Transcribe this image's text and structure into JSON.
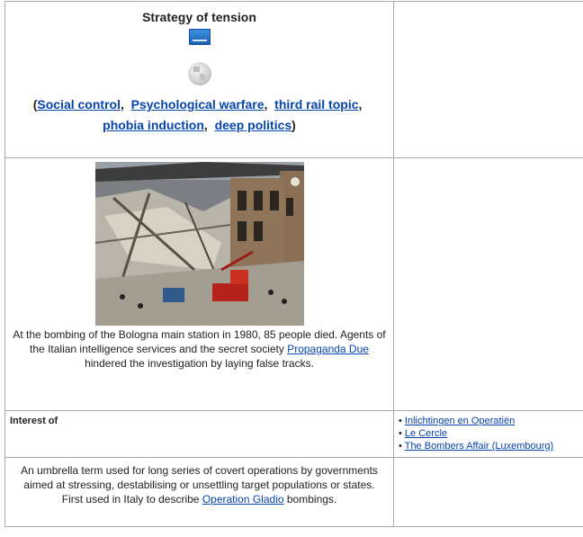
{
  "infobox": {
    "title": "Strategy of tension",
    "badge_icon": "info-badge-icon",
    "globe_icon": "wikipedia-globe-icon",
    "related": {
      "open_paren": "(",
      "close_paren": ")",
      "items": [
        {
          "label": "Social control"
        },
        {
          "label": "Psychological warfare"
        },
        {
          "label": "third rail topic"
        },
        {
          "label": "phobia induction"
        },
        {
          "label": "deep politics"
        }
      ]
    },
    "photo": {
      "subject": "Bologna station bombing aftermath",
      "caption_before": "At the bombing of the Bologna main station in 1980, 85 people died. Agents of the Italian intelligence services and the secret society ",
      "caption_link": "Propaganda Due",
      "caption_after": " hindered the investigation by laying false tracks."
    },
    "interest": {
      "label": "Interest of",
      "items": [
        {
          "label": "Inlichtingen en Operatiën"
        },
        {
          "label": "Le Cercle"
        },
        {
          "label": "The Bombers Affair (Luxembourg)"
        }
      ]
    },
    "description": {
      "text_before": "An umbrella term used for long series of covert operations by governments aimed at stressing, destabilising or unsettling target populations or states. First used in Italy to describe ",
      "link": "Operation Gladio",
      "text_after": " bombings."
    }
  },
  "colors": {
    "link": "#0645ad",
    "border": "#a2a9b1",
    "text": "#222222"
  }
}
